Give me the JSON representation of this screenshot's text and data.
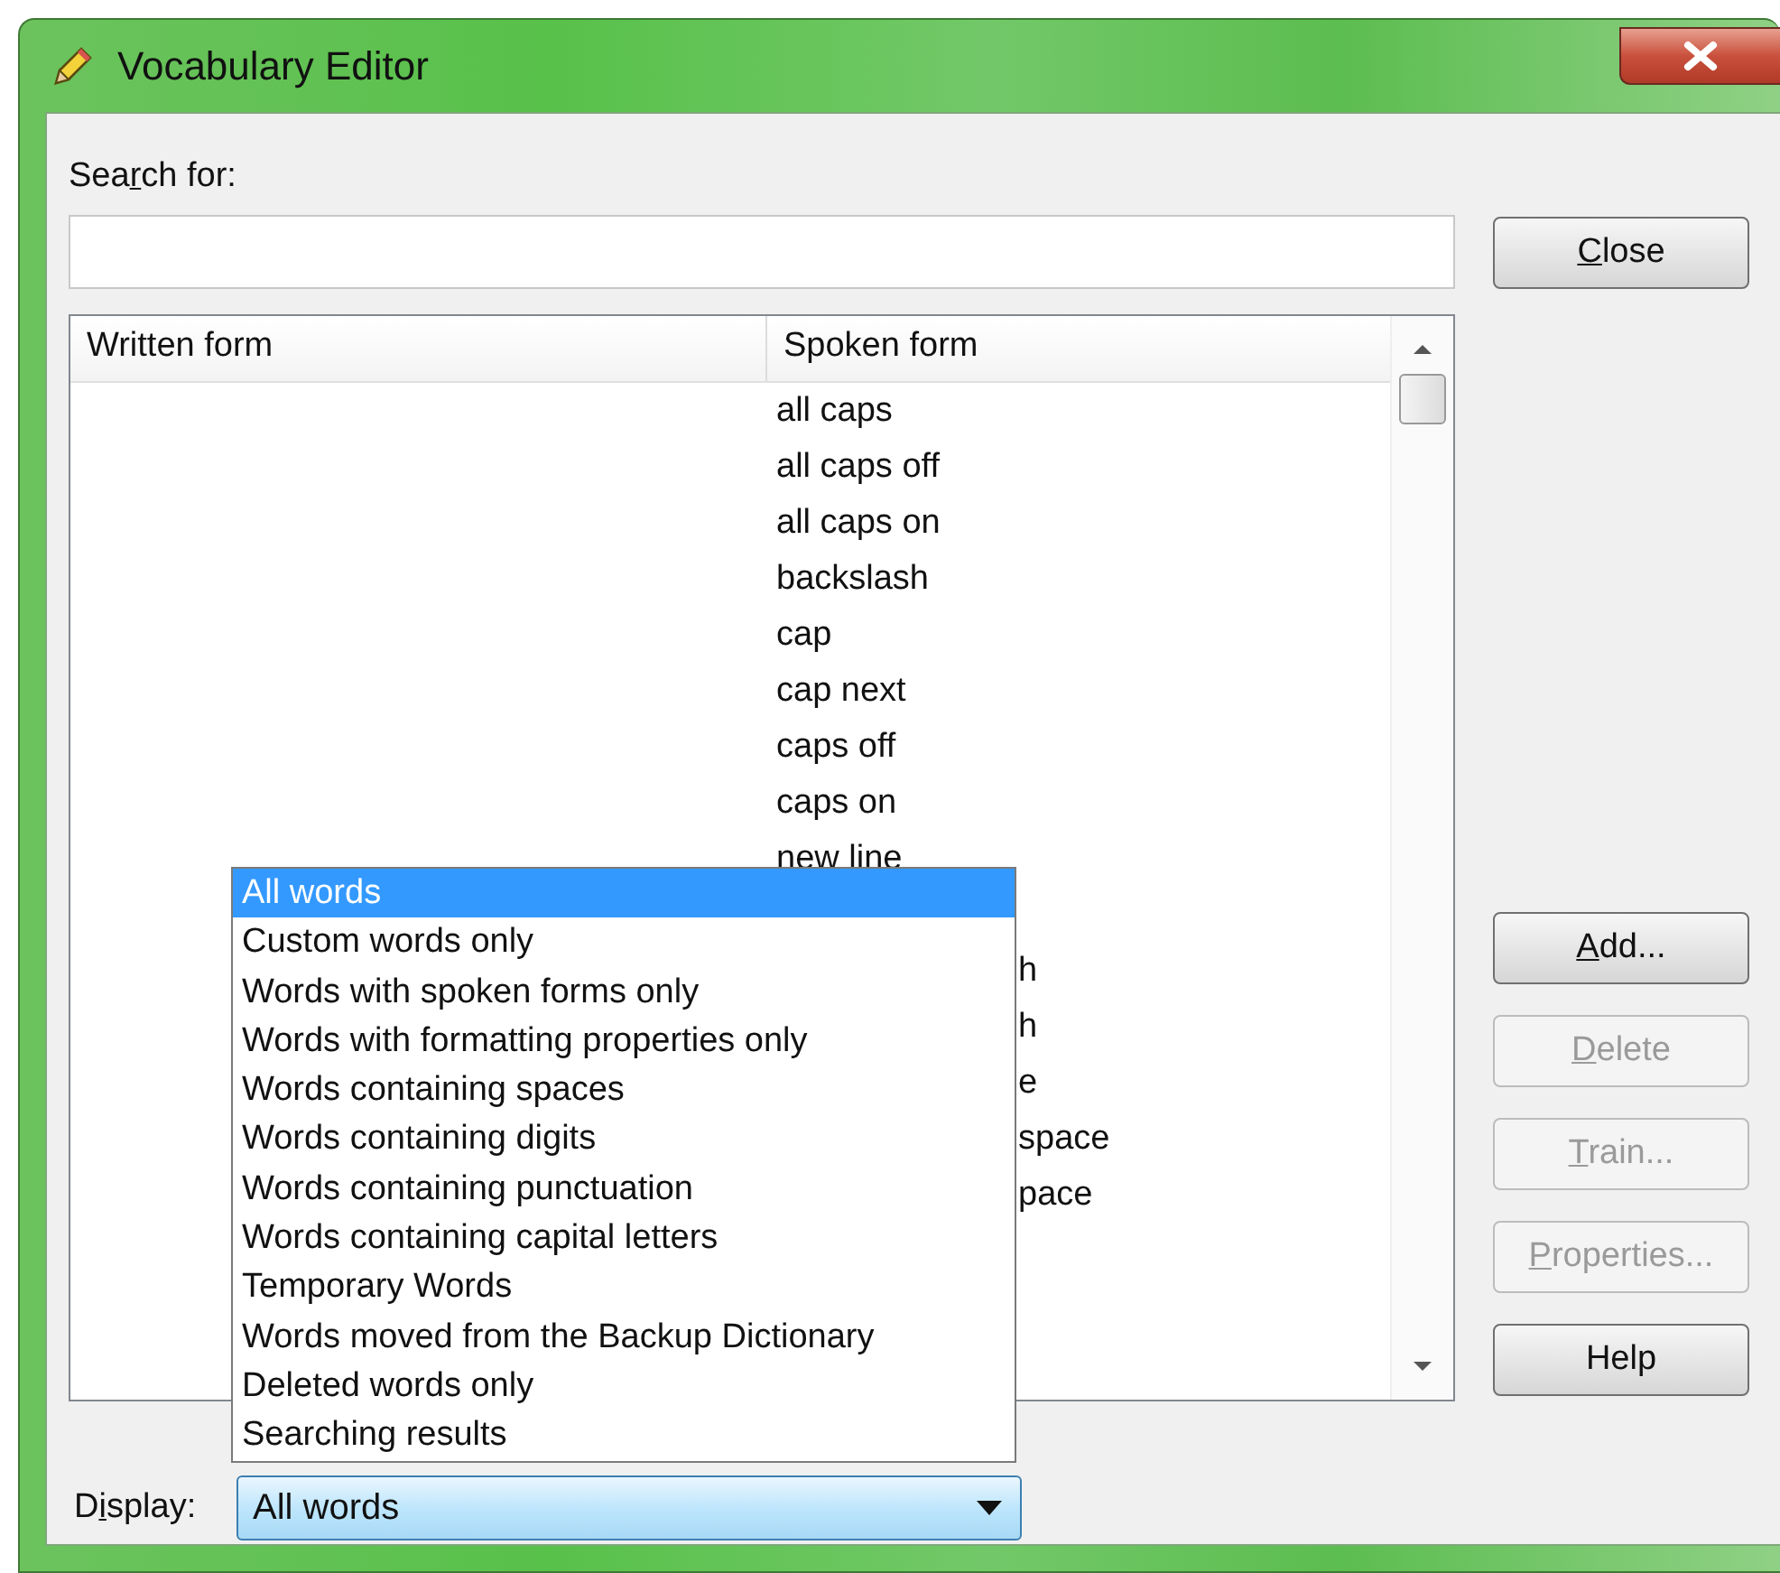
{
  "window": {
    "title": "Vocabulary Editor"
  },
  "search": {
    "label": {
      "before": "Sea",
      "key": "r",
      "after": "ch for:"
    }
  },
  "close_button": {
    "key": "C",
    "after": "lose",
    "disabled": false
  },
  "table": {
    "columns": [
      "Written form",
      "Spoken form"
    ],
    "rows": [
      {
        "kind": "full",
        "spoken_form": "all caps"
      },
      {
        "kind": "full",
        "spoken_form": "all caps off"
      },
      {
        "kind": "full",
        "spoken_form": "all caps on"
      },
      {
        "kind": "full",
        "spoken_form": "backslash"
      },
      {
        "kind": "full",
        "spoken_form": "cap"
      },
      {
        "kind": "full",
        "spoken_form": "cap next"
      },
      {
        "kind": "full",
        "spoken_form": "caps off"
      },
      {
        "kind": "full",
        "spoken_form": "caps on"
      },
      {
        "kind": "full",
        "spoken_form": "new line"
      },
      {
        "kind": "partial",
        "spoken_form": "h"
      },
      {
        "kind": "partial",
        "spoken_form": "h"
      },
      {
        "kind": "partial",
        "spoken_form": "e"
      },
      {
        "kind": "partial",
        "spoken_form": "space"
      },
      {
        "kind": "partial",
        "spoken_form": "pace"
      }
    ]
  },
  "buttons": [
    {
      "key": "A",
      "after": "dd...",
      "disabled": false
    },
    {
      "key": "D",
      "after": "elete",
      "disabled": true
    },
    {
      "key": "T",
      "after": "rain...",
      "disabled": true
    },
    {
      "key": "P",
      "after": "roperties...",
      "disabled": true
    },
    {
      "before": "Help",
      "disabled": false
    }
  ],
  "display": {
    "label": {
      "before": "D",
      "key": "i",
      "after": "splay:"
    },
    "value": "All words",
    "expanded": true,
    "options": [
      {
        "label": "All words",
        "selected": true
      },
      {
        "label": "Custom words only",
        "selected": false
      },
      {
        "label": "Words with spoken forms only",
        "selected": false
      },
      {
        "label": "Words with formatting properties only",
        "selected": false
      },
      {
        "label": "Words containing spaces",
        "selected": false
      },
      {
        "label": "Words containing digits",
        "selected": false
      },
      {
        "label": "Words containing punctuation",
        "selected": false
      },
      {
        "label": "Words containing capital letters",
        "selected": false
      },
      {
        "label": "Temporary Words",
        "selected": false
      },
      {
        "label": "Words moved from the Backup Dictionary",
        "selected": false
      },
      {
        "label": "Deleted words only",
        "selected": false
      },
      {
        "label": "Searching results",
        "selected": false
      }
    ]
  }
}
